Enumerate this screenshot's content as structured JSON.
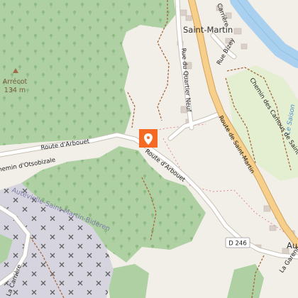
{
  "map": {
    "colors": {
      "land": "#f2efe9",
      "forest": "#aed0a2",
      "forest_tree": "#8bb980",
      "meadow": "#e4eed0",
      "industrial": "#d6d4de",
      "water": "#a9d0ee",
      "main_road": "#f6cf8a",
      "main_road_casing": "#d3a15f",
      "minor_road": "#ffffff",
      "track": "#a4693c",
      "boundary": "#e06d87",
      "marker": "#f46a25"
    },
    "place_labels": {
      "village": "Saint-Martin",
      "village_cut": "Au",
      "peak_name": "Arrécot",
      "peak_elevation": "134 m",
      "river": "Le Saison",
      "landuse_area": "Autevielle-Saint-Martin-Bideren"
    },
    "road_labels": {
      "route_arbouet_west": "Route d'Arbouet",
      "route_arbouet_east": "Route d'Arbouet",
      "route_saint_martin": "Route de Saint-Martin",
      "chemin_otsobizale": "Chemin d'Otsobizale",
      "rue_quartier_neuf": "Rue du Quartier Neuf",
      "rue_bizey": "Rue Bizey",
      "chemin_camous": "Chemin des Camous de Saint-Martin",
      "la_carriere": "La Carrière",
      "carriere_top": "Carrière",
      "la_garenne": "La Garenne"
    },
    "road_shield": "D 246",
    "icons": {
      "marker": "location-pin-icon",
      "peak": "peak-triangle-icon",
      "quarry": "quarry-pickaxe-icon"
    }
  }
}
